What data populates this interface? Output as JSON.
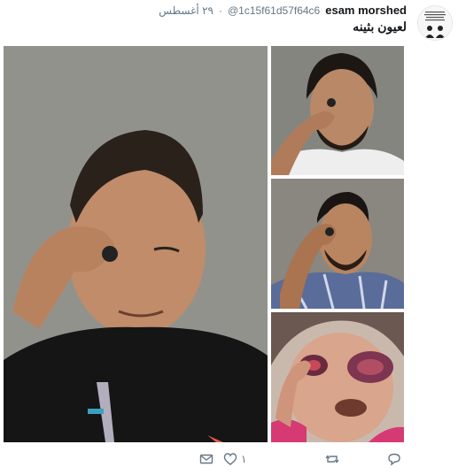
{
  "tweet": {
    "author_name": "esam morshed",
    "handle": "@1c15f61d57f64c6",
    "separator": "·",
    "date": "٢٩ أغسطس",
    "text": "لعيون بثينه",
    "like_count": "١"
  },
  "media": {
    "photos": [
      {
        "name": "man-covering-eye-main"
      },
      {
        "name": "bearded-man-covering-eye"
      },
      {
        "name": "young-man-covering-eye"
      },
      {
        "name": "injured-child-swollen-eye"
      }
    ]
  },
  "actions": {
    "icons": [
      "reply-icon",
      "retweet-icon",
      "like-icon",
      "direct-message-icon"
    ]
  },
  "colors": {
    "text_primary": "#14171a",
    "text_secondary": "#657786",
    "border": "#e1e8ed"
  }
}
